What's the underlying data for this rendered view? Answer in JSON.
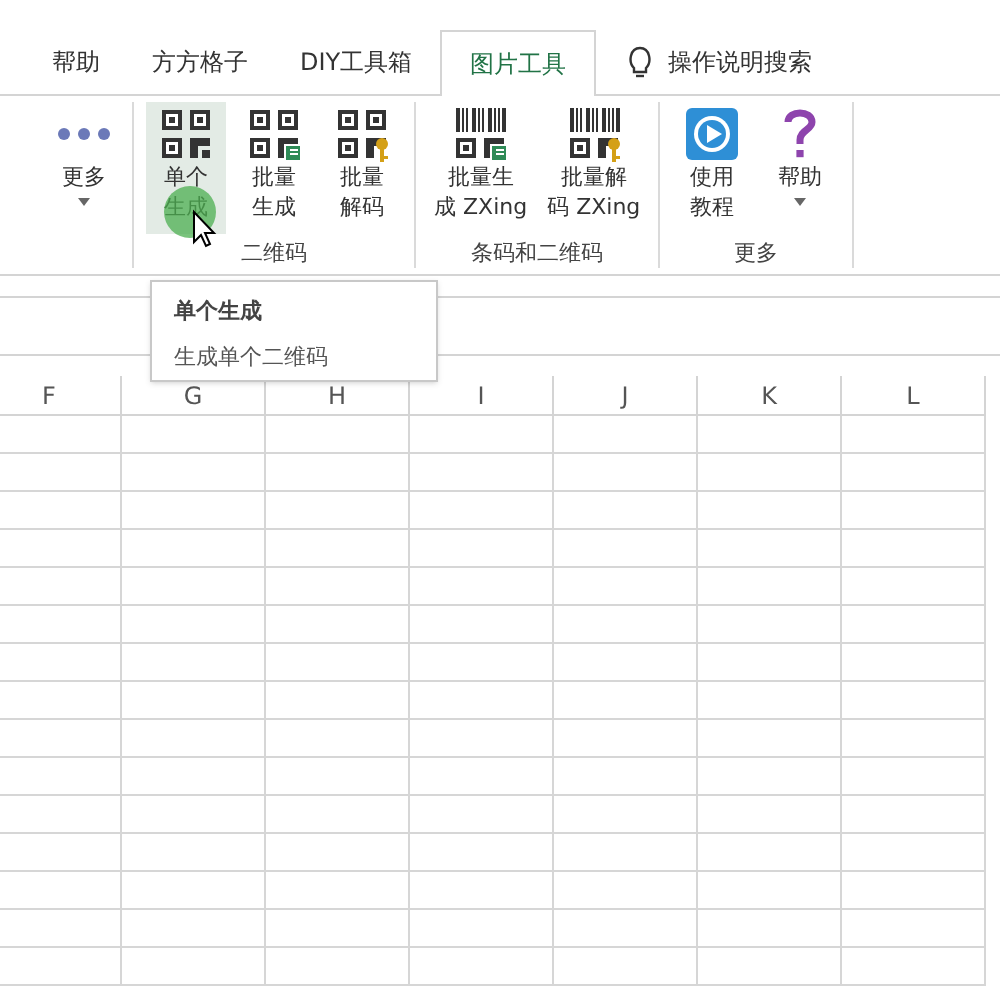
{
  "tabs": [
    {
      "label": "帮助",
      "selected": false
    },
    {
      "label": "方方格子",
      "selected": false
    },
    {
      "label": "DIY工具箱",
      "selected": false
    },
    {
      "label": "图片工具",
      "selected": true
    }
  ],
  "search": {
    "label": "操作说明搜索"
  },
  "ribbon": {
    "groups": [
      {
        "buttons": [
          {
            "kind": "more",
            "lines": [
              "更多"
            ],
            "caret": true,
            "hovered": false
          }
        ]
      },
      {
        "label": "二维码",
        "buttons": [
          {
            "kind": "single",
            "lines": [
              "单个",
              "生成"
            ],
            "caret": false,
            "hovered": true
          },
          {
            "kind": "batch",
            "lines": [
              "批量",
              "生成"
            ],
            "caret": false,
            "hovered": false
          },
          {
            "kind": "decode",
            "lines": [
              "批量",
              "解码"
            ],
            "caret": false,
            "hovered": false
          }
        ]
      },
      {
        "label": "条码和二维码",
        "buttons": [
          {
            "kind": "barcode-batch",
            "lines": [
              "批量生",
              "成 ZXing"
            ],
            "caret": false,
            "hovered": false
          },
          {
            "kind": "barcode-decode",
            "lines": [
              "批量解",
              "码 ZXing"
            ],
            "caret": false,
            "hovered": false
          }
        ]
      },
      {
        "label": "更多",
        "buttons": [
          {
            "kind": "tutorial",
            "lines": [
              "使用",
              "教程"
            ],
            "caret": false,
            "hovered": false
          },
          {
            "kind": "help",
            "lines": [
              "帮助"
            ],
            "caret": true,
            "hovered": false
          }
        ]
      }
    ]
  },
  "tooltip": {
    "title": "单个生成",
    "text": "生成单个二维码"
  },
  "columns": [
    "F",
    "G",
    "H",
    "I",
    "J",
    "K",
    "L"
  ]
}
